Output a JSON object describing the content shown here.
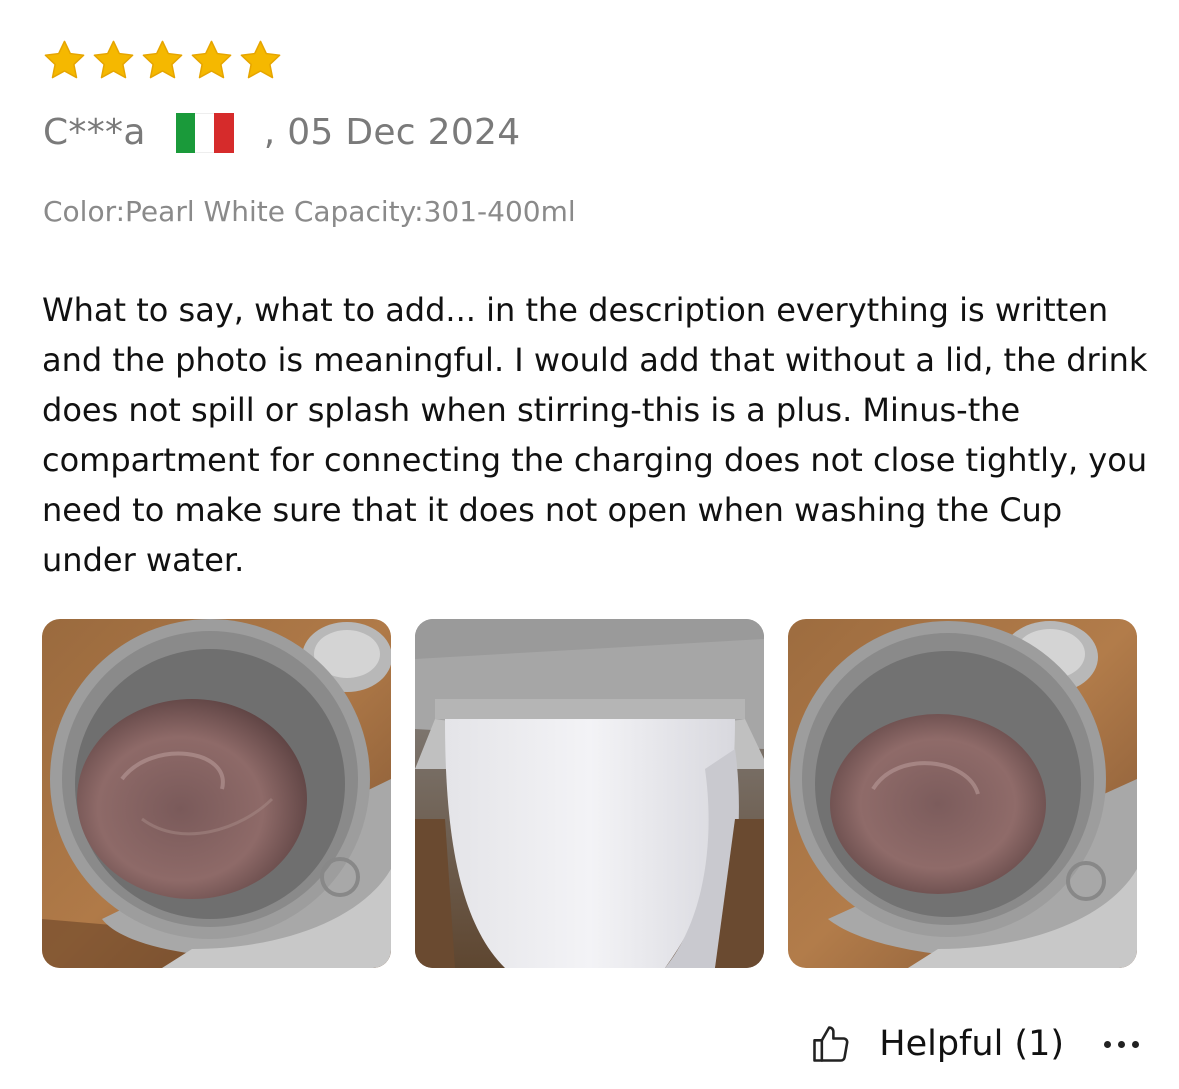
{
  "review": {
    "rating": 5,
    "star_color": "#f5b800",
    "author": "C***a",
    "country_flag": "italy-flag",
    "flag_colors": [
      "#1a9a3a",
      "#ffffff",
      "#d62b2b"
    ],
    "date": ", 05 Dec 2024",
    "variant": "Color:Pearl White Capacity:301-400ml",
    "text": "What to say, what to add... in the description everything is written and the photo is meaningful. I would add that without a lid, the drink does not spill or splash when stirring-this is a plus. Minus-the compartment for connecting the charging does not close tightly, you need to make sure that it does not open when washing the Cup under water.",
    "photos": [
      {
        "name": "review-photo-1",
        "content": "grey self-stirring mug top view with brown drink on wooden table"
      },
      {
        "name": "review-photo-2",
        "content": "grey self-stirring mug side view with white base"
      },
      {
        "name": "review-photo-3",
        "content": "grey self-stirring mug top view with brown drink on wooden table"
      }
    ],
    "helpful_label": "Helpful (1)"
  }
}
